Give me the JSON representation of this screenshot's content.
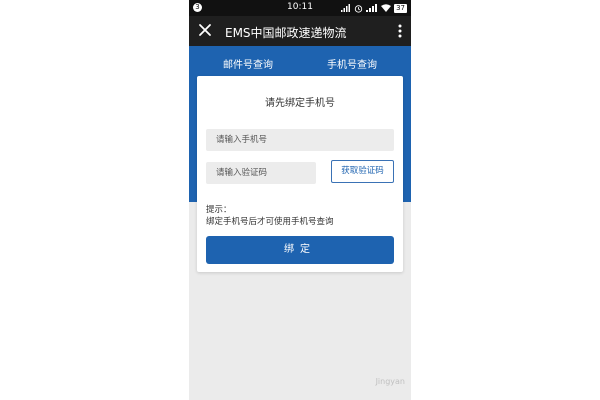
{
  "status_bar": {
    "notification_count": "3",
    "time": "10:11",
    "battery": "37"
  },
  "app_bar": {
    "title": "EMS中国邮政速递物流"
  },
  "tabs": [
    {
      "label": "邮件号查询"
    },
    {
      "label": "手机号查询"
    }
  ],
  "card": {
    "title": "请先绑定手机号",
    "phone_placeholder": "请输入手机号",
    "code_placeholder": "请输入验证码",
    "get_code_label": "获取验证码",
    "tip_label": "提示：",
    "tip_text": "绑定手机号后才可使用手机号查询",
    "bind_label": "绑定"
  },
  "watermark": "Jingyan",
  "colors": {
    "brand_blue": "#1e63b0",
    "app_bar": "#1f1f1f",
    "status_bar": "#111111",
    "page_background": "#ebebeb"
  }
}
